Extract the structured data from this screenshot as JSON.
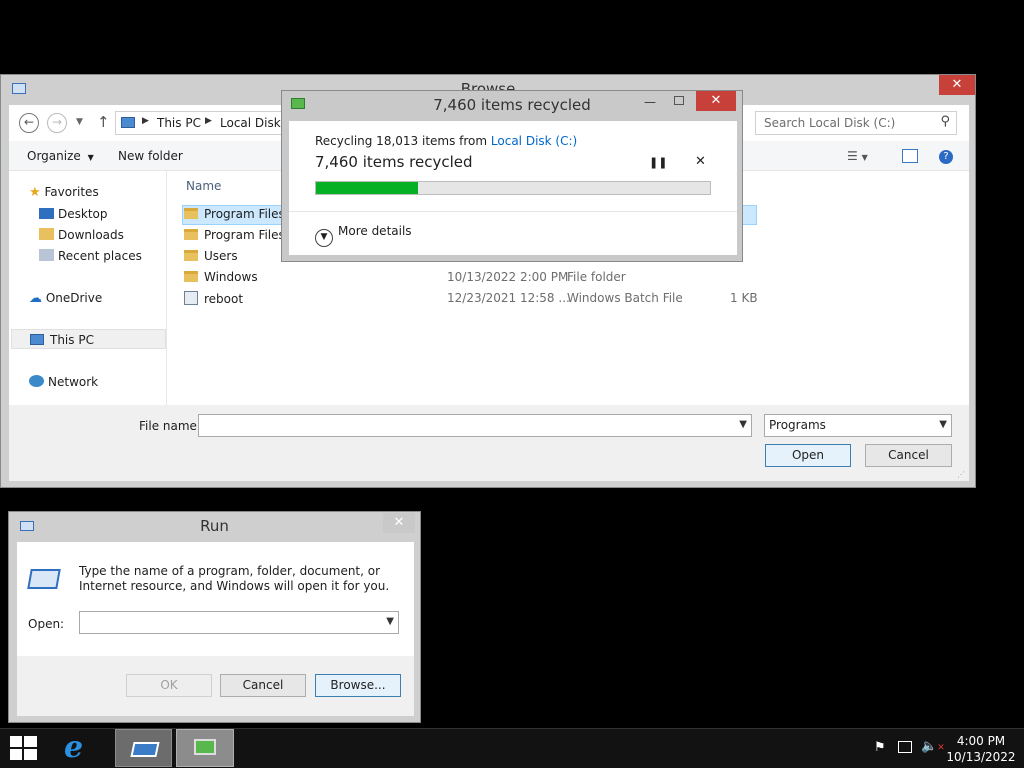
{
  "browse": {
    "title": "Browse",
    "address": [
      "This PC",
      "Local Disk (C:)"
    ],
    "search_placeholder": "Search Local Disk (C:)",
    "toolbar": {
      "organize": "Organize",
      "new_folder": "New folder"
    },
    "nav": {
      "favorites": "Favorites",
      "favorites_items": [
        "Desktop",
        "Downloads",
        "Recent places"
      ],
      "onedrive": "OneDrive",
      "thispc": "This PC",
      "network": "Network"
    },
    "column_name": "Name",
    "files": [
      {
        "name": "Program Files",
        "date": "",
        "type": "",
        "size": ""
      },
      {
        "name": "Program Files (x86)",
        "date": "",
        "type": "",
        "size": ""
      },
      {
        "name": "Users",
        "date": "",
        "type": "",
        "size": ""
      },
      {
        "name": "Windows",
        "date": "10/13/2022 2:00 PM",
        "type": "File folder",
        "size": ""
      },
      {
        "name": "reboot",
        "date": "12/23/2021 12:58 ...",
        "type": "Windows Batch File",
        "size": "1 KB"
      }
    ],
    "filename_label": "File name:",
    "filename_value": "",
    "filter": "Programs",
    "open": "Open",
    "cancel": "Cancel"
  },
  "recycle": {
    "title": "7,460 items recycled",
    "line1_prefix": "Recycling 18,013 items from ",
    "line1_link": "Local Disk (C:)",
    "status": "7,460 items recycled",
    "progress": 0.26,
    "more_details": "More details",
    "pause_icon": "pause-icon",
    "stop_icon": "close-icon"
  },
  "run": {
    "title": "Run",
    "description": "Type the name of a program, folder, document, or Internet resource, and Windows will open it for you.",
    "open_label": "Open:",
    "open_value": "",
    "ok": "OK",
    "cancel": "Cancel",
    "browse": "Browse..."
  },
  "taskbar": {
    "time": "4:00 PM",
    "date": "10/13/2022"
  },
  "colors": {
    "accent_green": "#06b025",
    "close_red": "#c7413a",
    "link_blue": "#0066cc"
  }
}
